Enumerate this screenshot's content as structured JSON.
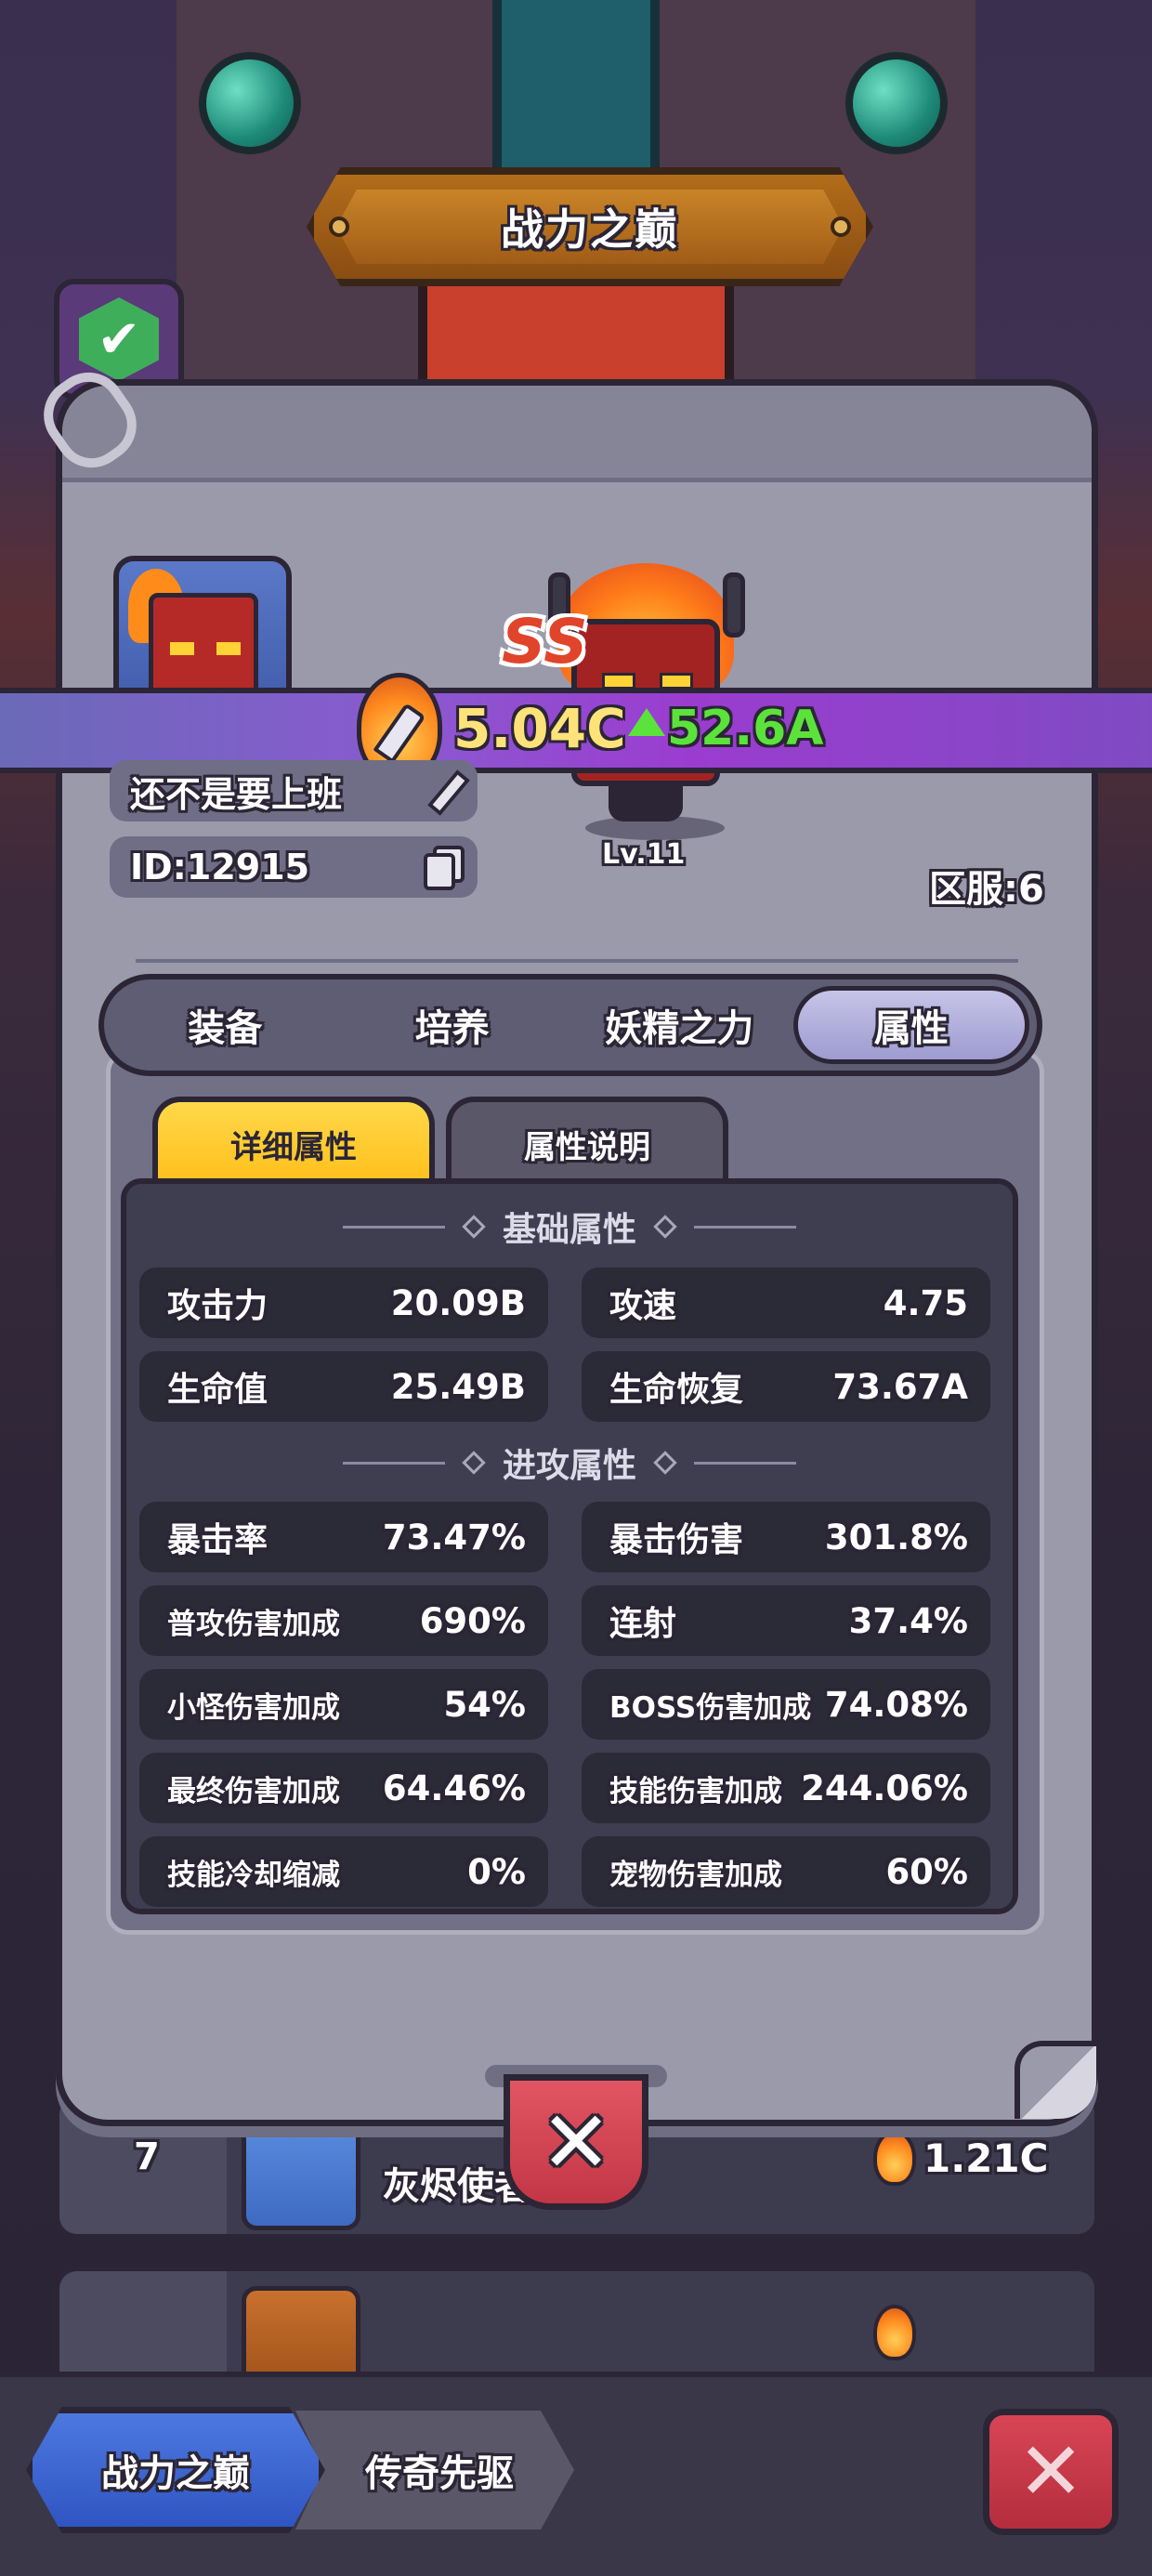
{
  "title": "战力之巅",
  "player": {
    "rank_grade": "SS",
    "name": "还不是要上班",
    "id_label": "ID:12915",
    "level": "Lv.11",
    "server": "区服:6",
    "power": "5.04C",
    "power_increase": "52.6A"
  },
  "tabs": [
    "装备",
    "培养",
    "妖精之力",
    "属性"
  ],
  "active_tab_index": 3,
  "sub_tabs": {
    "detail": "详细属性",
    "explain": "属性说明"
  },
  "sections": [
    {
      "title": "基础属性",
      "stats": [
        {
          "name": "攻击力",
          "value": "20.09B"
        },
        {
          "name": "攻速",
          "value": "4.75"
        },
        {
          "name": "生命值",
          "value": "25.49B"
        },
        {
          "name": "生命恢复",
          "value": "73.67A"
        }
      ]
    },
    {
      "title": "进攻属性",
      "stats": [
        {
          "name": "暴击率",
          "value": "73.47%"
        },
        {
          "name": "暴击伤害",
          "value": "301.8%"
        },
        {
          "name": "普攻伤害加成",
          "value": "690%"
        },
        {
          "name": "连射",
          "value": "37.4%"
        },
        {
          "name": "小怪伤害加成",
          "value": "54%"
        },
        {
          "name": "BOSS伤害加成",
          "value": "74.08%"
        },
        {
          "name": "最终伤害加成",
          "value": "64.46%"
        },
        {
          "name": "技能伤害加成",
          "value": "244.06%"
        },
        {
          "name": "技能冷却缩减",
          "value": "0%"
        },
        {
          "name": "宠物伤害加成",
          "value": "60%"
        }
      ]
    }
  ],
  "leaderboard_behind": [
    {
      "rank": "7",
      "name": "灰烬使者",
      "power": "1.21C"
    }
  ],
  "bottom_tabs": [
    "战力之巅",
    "传奇先驱"
  ],
  "icons": {
    "close": "close-icon",
    "edit": "pencil-icon",
    "copy": "copy-icon",
    "power": "fire-sword-icon",
    "check": "check-icon"
  },
  "colors": {
    "accent_yellow": "#ffd84a",
    "power_text": "#ffe37a",
    "increase_green": "#5be33b",
    "close_red": "#c23646"
  }
}
